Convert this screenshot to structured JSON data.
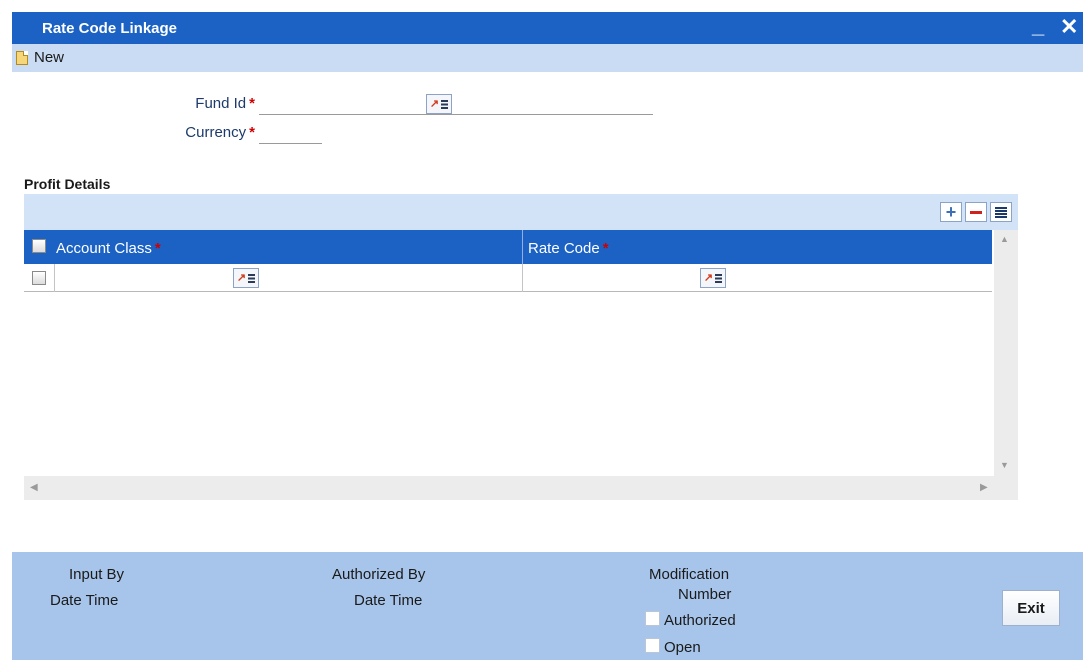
{
  "window": {
    "title": "Rate Code Linkage",
    "minimize_glyph": "▁",
    "close_glyph": "✕"
  },
  "toolbar": {
    "new_label": "New",
    "new_icon": "document-icon"
  },
  "form": {
    "fund_id_label": "Fund Id",
    "currency_label": "Currency",
    "required_mark": "*",
    "fund_id_value": "",
    "currency_value": ""
  },
  "profit_details": {
    "title": "Profit Details",
    "columns": [
      "Account Class",
      "Rate Code"
    ],
    "rows": [
      {
        "account_class": "",
        "rate_code": ""
      }
    ]
  },
  "footer": {
    "input_by": "Input By",
    "date_time_1": "Date Time",
    "authorized_by": "Authorized By",
    "date_time_2": "Date Time",
    "modification": "Modification",
    "number": "Number",
    "authorized": "Authorized",
    "open": "Open",
    "exit_label": "Exit"
  },
  "colors": {
    "titlebar": "#1b62c4",
    "toolbar": "#c9dcf4",
    "grid_panel": "#d3e3f7",
    "footer": "#a7c5ea",
    "required": "#cc0000"
  }
}
